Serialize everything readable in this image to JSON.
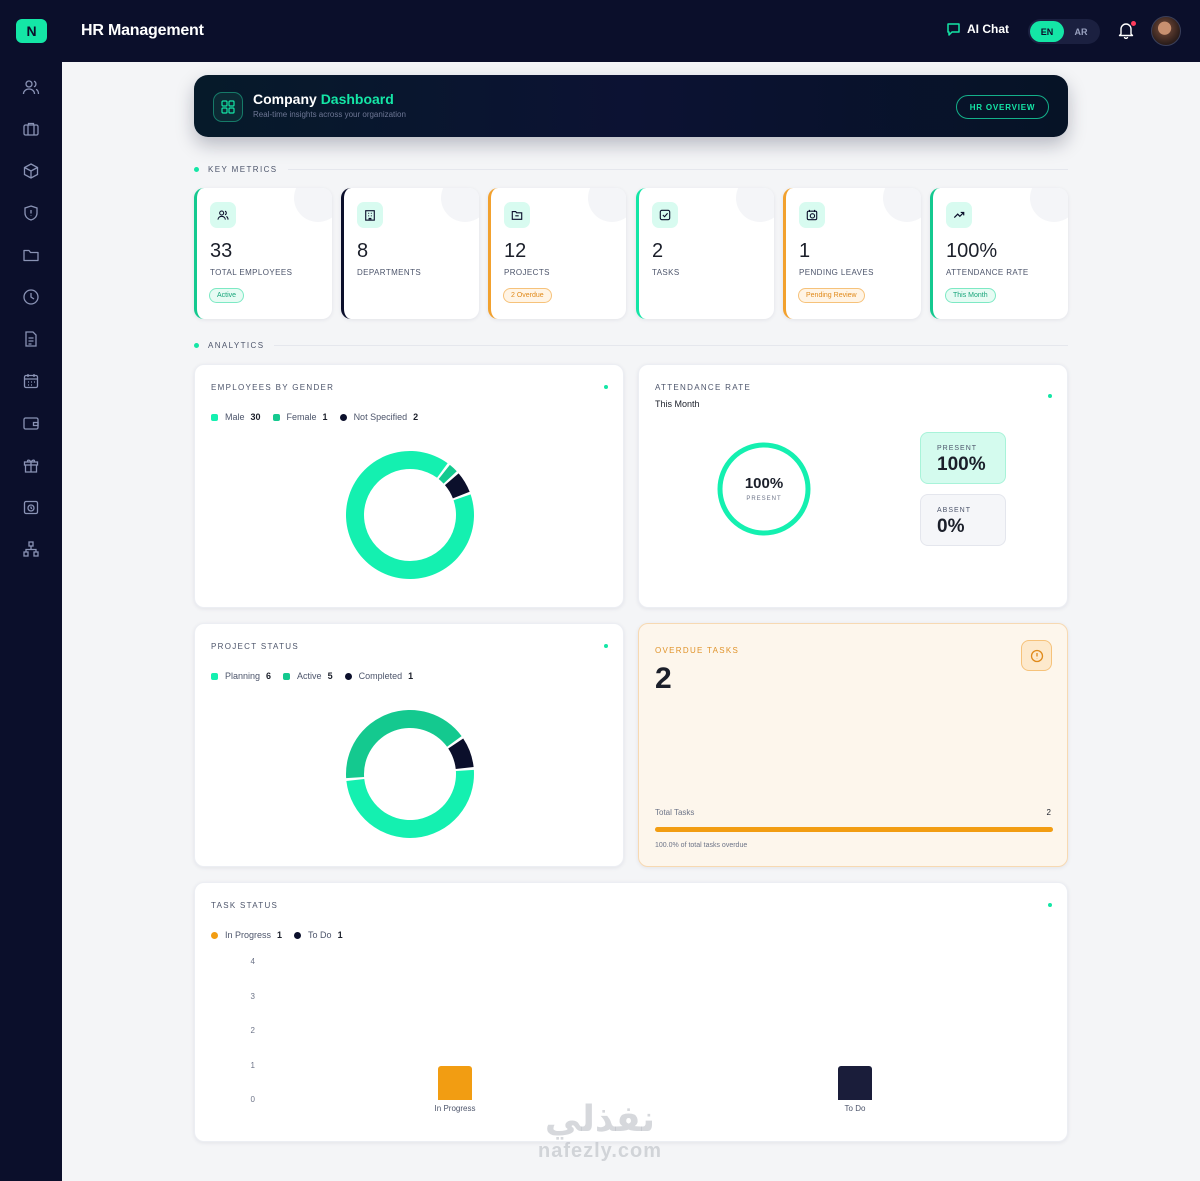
{
  "app": {
    "logo_letter": "N",
    "title": "HR Management"
  },
  "topbar": {
    "ai_chat_label": "AI Chat",
    "lang_en": "EN",
    "lang_ar": "AR"
  },
  "banner": {
    "title_main": "Company",
    "title_accent": "Dashboard",
    "subtitle": "Real-time insights across your organization",
    "button_label": "HR OVERVIEW"
  },
  "sections": {
    "key_metrics": "KEY METRICS",
    "analytics": "ANALYTICS"
  },
  "metrics": [
    {
      "value": "33",
      "label": "TOTAL EMPLOYEES",
      "badge": "Active",
      "badge_style": "green",
      "accent": "#14c98f",
      "icon": "users-icon"
    },
    {
      "value": "8",
      "label": "DEPARTMENTS",
      "badge": "",
      "badge_style": "",
      "accent": "#0b0f2b",
      "icon": "building-icon"
    },
    {
      "value": "12",
      "label": "PROJECTS",
      "badge": "2 Overdue",
      "badge_style": "orange",
      "accent": "#f2a12e",
      "icon": "folder-icon"
    },
    {
      "value": "2",
      "label": "TASKS",
      "badge": "",
      "badge_style": "",
      "accent": "#14e6a6",
      "icon": "check-square-icon"
    },
    {
      "value": "1",
      "label": "PENDING LEAVES",
      "badge": "Pending Review",
      "badge_style": "orange",
      "accent": "#f2a12e",
      "icon": "calendar-clock-icon"
    },
    {
      "value": "100%",
      "label": "ATTENDANCE RATE",
      "badge": "This Month",
      "badge_style": "green",
      "accent": "#14c98f",
      "icon": "trending-up-icon"
    }
  ],
  "gender_panel": {
    "title": "EMPLOYEES BY GENDER",
    "legend": [
      {
        "label": "Male",
        "value": "30",
        "color": "#14f0b0"
      },
      {
        "label": "Female",
        "value": "1",
        "color": "#14c98f"
      },
      {
        "label": "Not Specified",
        "value": "2",
        "color": "#0b0f2b"
      }
    ]
  },
  "attendance_panel": {
    "title": "ATTENDANCE RATE",
    "subtitle": "This Month",
    "ring_value": "100%",
    "ring_label": "PRESENT",
    "present_label": "PRESENT",
    "present_value": "100%",
    "absent_label": "ABSENT",
    "absent_value": "0%"
  },
  "project_panel": {
    "title": "PROJECT STATUS",
    "legend": [
      {
        "label": "Planning",
        "value": "6",
        "color": "#14f0b0"
      },
      {
        "label": "Active",
        "value": "5",
        "color": "#14c98f"
      },
      {
        "label": "Completed",
        "value": "1",
        "color": "#0b0f2b"
      }
    ]
  },
  "overdue_panel": {
    "title": "OVERDUE TASKS",
    "value": "2",
    "total_label": "Total Tasks",
    "total_value": "2",
    "progress": 1.0,
    "footnote": "100.0% of total tasks overdue"
  },
  "task_panel": {
    "title": "TASK STATUS",
    "legend": [
      {
        "label": "In Progress",
        "value": "1",
        "color": "#f29d12"
      },
      {
        "label": "To Do",
        "value": "1",
        "color": "#0b0f2b"
      }
    ]
  },
  "chart_data": [
    {
      "type": "pie",
      "title": "EMPLOYEES BY GENDER",
      "categories": [
        "Male",
        "Female",
        "Not Specified"
      ],
      "values": [
        30,
        1,
        2
      ],
      "colors": [
        "#14f0b0",
        "#14c98f",
        "#0b0f2b"
      ]
    },
    {
      "type": "pie",
      "title": "PROJECT STATUS",
      "categories": [
        "Planning",
        "Active",
        "Completed"
      ],
      "values": [
        6,
        5,
        1
      ],
      "colors": [
        "#14f0b0",
        "#14c98f",
        "#0b0f2b"
      ]
    },
    {
      "type": "bar",
      "title": "TASK STATUS",
      "categories": [
        "In Progress",
        "To Do"
      ],
      "values": [
        1,
        1
      ],
      "colors": [
        "#f29d12",
        "#1a1d3a"
      ],
      "ylim": [
        0,
        4
      ],
      "yticks": [
        0,
        1,
        2,
        3,
        4
      ]
    }
  ],
  "watermark": {
    "arabic": "نفذلي",
    "latin": "nafezly.com"
  }
}
